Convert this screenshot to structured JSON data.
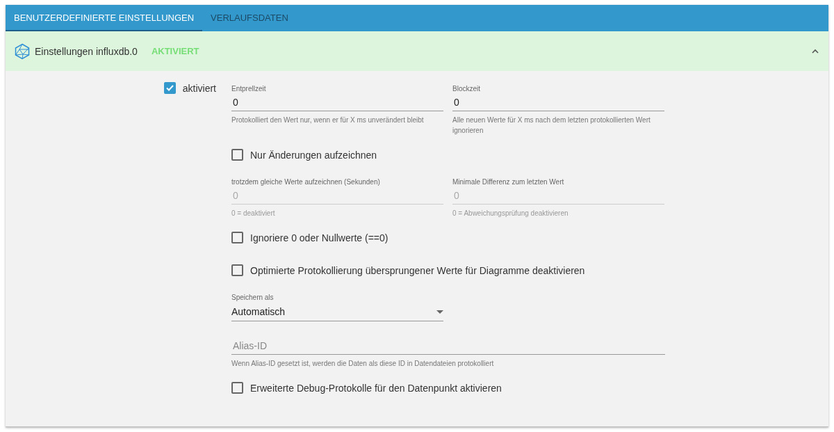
{
  "tabs": [
    {
      "label": "BENUTZERDEFINIERTE EINSTELLUNGEN",
      "selected": true
    },
    {
      "label": "VERLAUFSDATEN",
      "selected": false
    }
  ],
  "panel": {
    "title": "Einstellungen influxdb.0",
    "status": "AKTIVIERT",
    "expanded": true
  },
  "enabled": {
    "label": "aktiviert",
    "checked": true
  },
  "rows": [
    {
      "kind": "pair",
      "fields": [
        {
          "label": "Entprellzeit",
          "value": "0",
          "helper": "Protokolliert den Wert nur, wenn er für X ms unverändert bleibt",
          "disabled": false
        },
        {
          "label": "Blockzeit",
          "value": "0",
          "helper": "Alle neuen Werte für X ms nach dem letzten protokollierten Wert ignorieren",
          "disabled": false
        }
      ]
    },
    {
      "kind": "checkbox",
      "label": "Nur Änderungen aufzeichnen",
      "checked": false
    },
    {
      "kind": "pair",
      "fields": [
        {
          "label": "trotzdem gleiche Werte aufzeichnen (Sekunden)",
          "value": "0",
          "helper": "0 = deaktiviert",
          "disabled": true
        },
        {
          "label": "Minimale Differenz zum letzten Wert",
          "value": "0",
          "helper": "0 = Abweichungsprüfung deaktivieren",
          "disabled": true
        }
      ]
    },
    {
      "kind": "checkbox",
      "label": "Ignoriere 0 oder Nullwerte (==0)",
      "checked": false
    },
    {
      "kind": "checkbox",
      "label": "Optimierte Protokollierung übersprungener Werte für Diagramme deaktivieren",
      "checked": false
    },
    {
      "kind": "select",
      "label": "Speichern als",
      "value": "Automatisch"
    },
    {
      "kind": "field",
      "placeholder": "Alias-ID",
      "helper": "Wenn Alias-ID gesetzt ist, werden die Daten als diese ID in Datendateien protokolliert"
    },
    {
      "kind": "checkbox",
      "label": "Erweiterte Debug-Protokolle für den Datenpunkt aktivieren",
      "checked": false
    }
  ]
}
